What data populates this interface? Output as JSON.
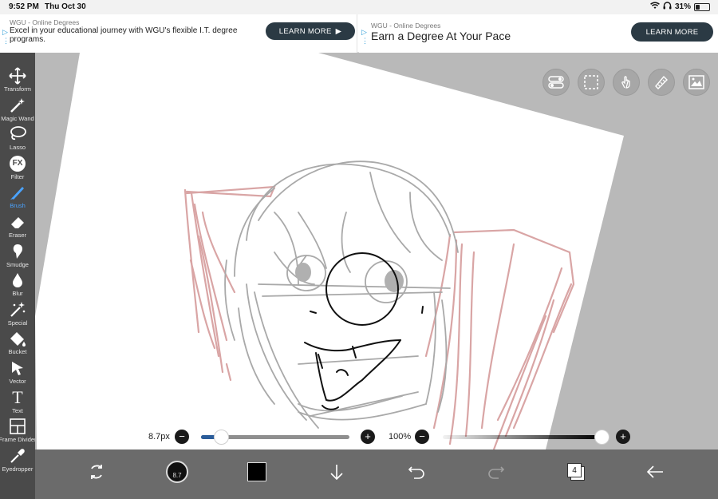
{
  "status": {
    "time": "9:52 PM",
    "date": "Thu Oct 30",
    "battery_text": "31%",
    "battery_level": 0.31
  },
  "ads": [
    {
      "source": "WGU - Online Degrees",
      "text": "Excel in your educational journey with WGU's flexible I.T. degree programs.",
      "button": "LEARN MORE"
    },
    {
      "source": "WGU - Online Degrees",
      "text": "Earn a Degree At Your Pace",
      "button": "LEARN MORE"
    }
  ],
  "tools": [
    {
      "label": "Transform",
      "icon": "transform-icon"
    },
    {
      "label": "Magic Wand",
      "icon": "magic-wand-icon"
    },
    {
      "label": "Lasso",
      "icon": "lasso-icon"
    },
    {
      "label": "Filter",
      "icon": "fx-icon",
      "glyph": "FX"
    },
    {
      "label": "Brush",
      "icon": "brush-icon",
      "active": true
    },
    {
      "label": "Eraser",
      "icon": "eraser-icon"
    },
    {
      "label": "Smudge",
      "icon": "smudge-icon"
    },
    {
      "label": "Blur",
      "icon": "blur-icon"
    },
    {
      "label": "Special",
      "icon": "special-icon"
    },
    {
      "label": "Bucket",
      "icon": "bucket-icon"
    },
    {
      "label": "Vector",
      "icon": "vector-icon"
    },
    {
      "label": "Text",
      "icon": "text-icon",
      "glyph": "T"
    },
    {
      "label": "Frame Divider",
      "icon": "frame-divider-icon"
    },
    {
      "label": "Eyedropper",
      "icon": "eyedropper-icon"
    }
  ],
  "brush_size": {
    "label": "8.7px",
    "fraction": 0.14
  },
  "opacity": {
    "label": "100%",
    "fraction": 1.0
  },
  "color_swatch": "#000000",
  "brush_preview_label": "8.7",
  "layers_count": "4",
  "colors": {
    "accent": "#4aa3ff",
    "sketch_red": "#d9a5a5",
    "sketch_grey": "#a9a9a9",
    "ink": "#111111"
  }
}
